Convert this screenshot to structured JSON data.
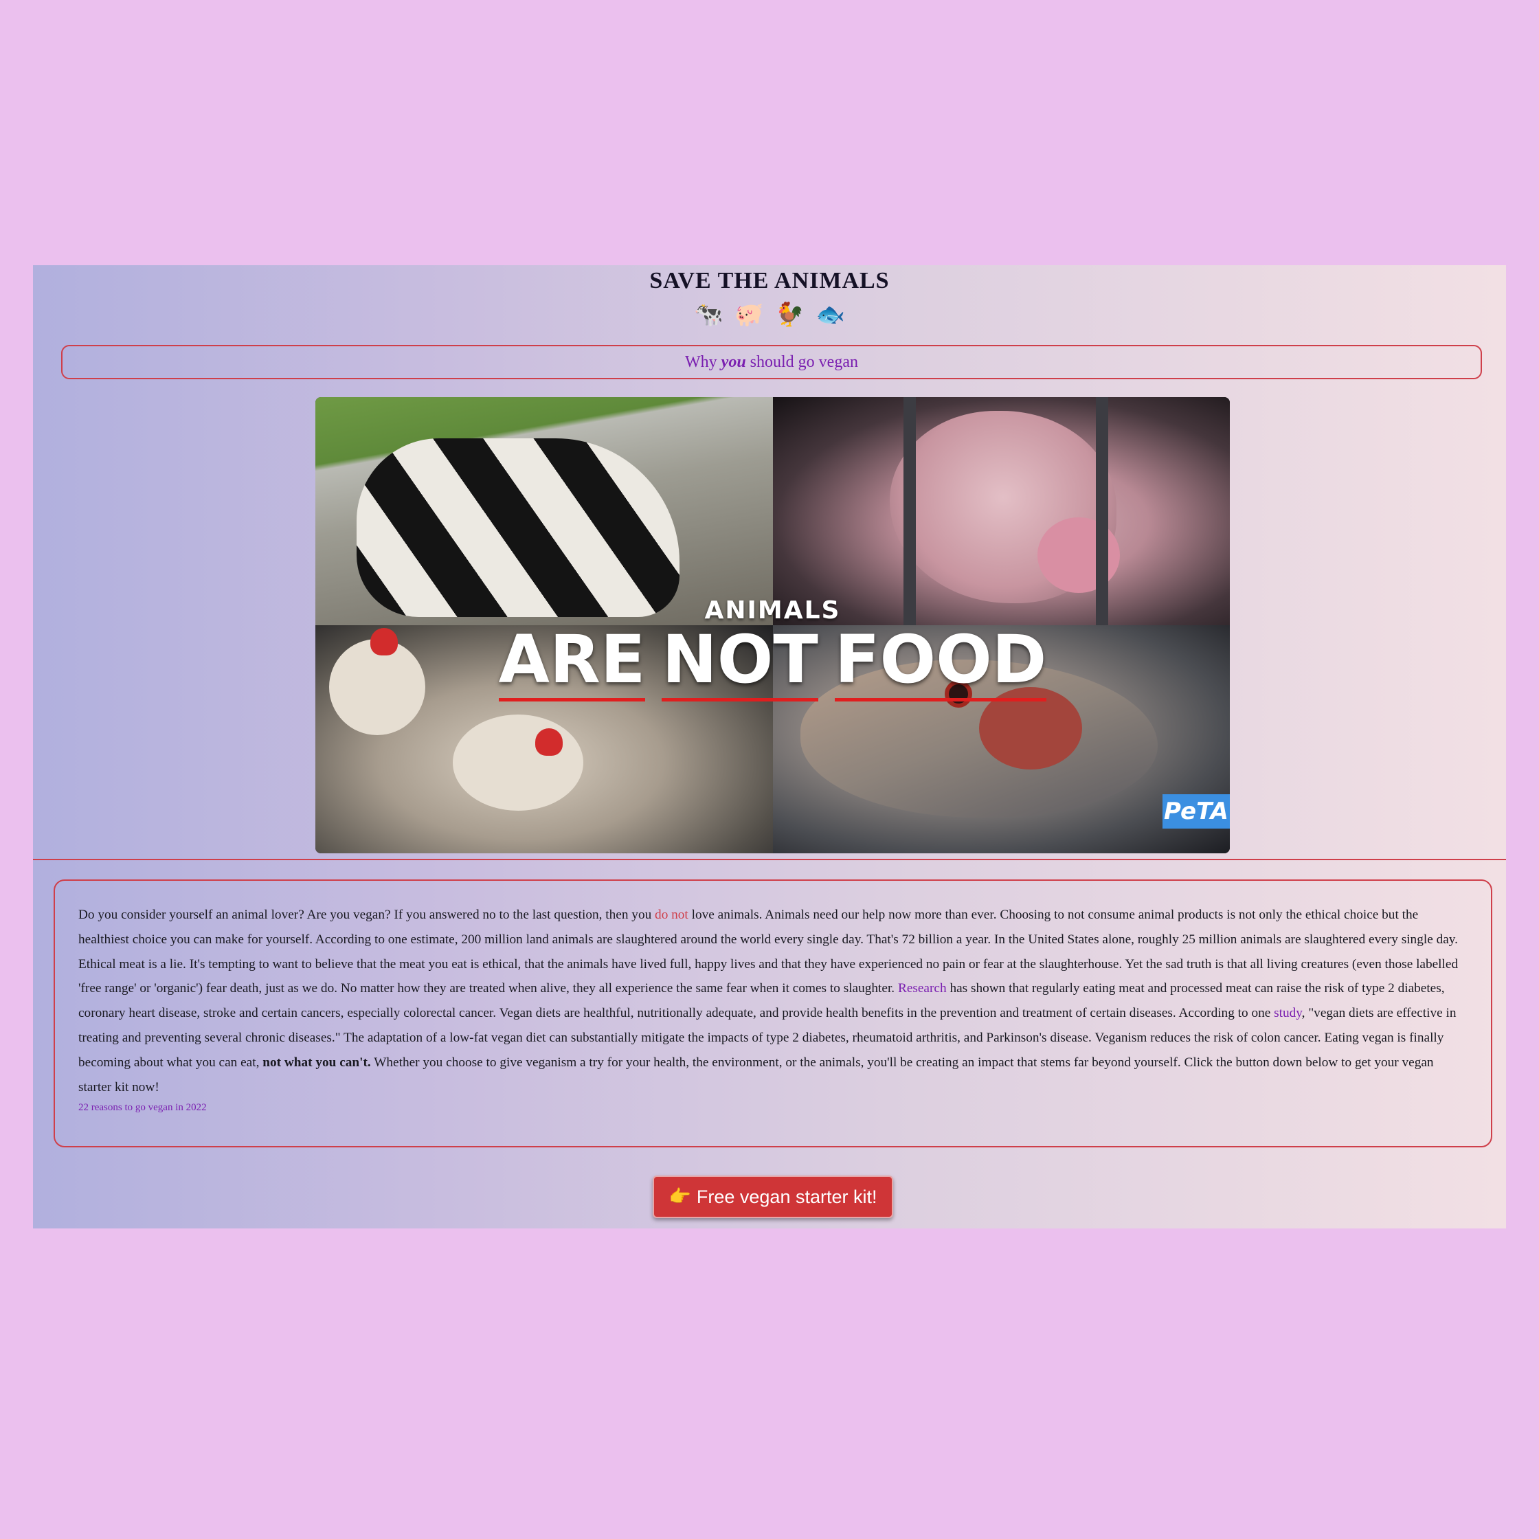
{
  "header": {
    "title": "SAVE THE ANIMALS",
    "animals": [
      "cow-icon",
      "pig-icon",
      "chicken-icon",
      "fish-icon"
    ],
    "animal_glyphs": [
      "🐄",
      "🐖",
      "🐓",
      "🐟"
    ]
  },
  "why": {
    "before": "Why ",
    "emph": "you",
    "after": " should go vegan"
  },
  "hero": {
    "line1": "ANIMALS",
    "word1": "ARE",
    "word2": "NOT",
    "word3": "FOOD",
    "logo": "PeTA"
  },
  "article": {
    "part1": "Do you consider yourself an animal lover? Are you vegan? If you answered no to the last question, then you ",
    "do_not": "do not",
    "part2": " love animals. Animals need our help now more than ever. Choosing to not consume animal products is not only the ethical choice but the healthiest choice you can make for yourself. According to one estimate, 200 million land animals are slaughtered around the world every single day. That's 72 billion a year. In the United States alone, roughly 25 million animals are slaughtered every single day. Ethical meat is a lie. It's tempting to want to believe that the meat you eat is ethical, that the animals have lived full, happy lives and that they have experienced no pain or fear at the slaughterhouse. Yet the sad truth is that all living creatures (even those labelled 'free range' or 'organic') fear death, just as we do. No matter how they are treated when alive, they all experience the same fear when it comes to slaughter. ",
    "research_link": "Research",
    "part3": " has shown that regularly eating meat and processed meat can raise the risk of type 2 diabetes, coronary heart disease, stroke and certain cancers, especially colorectal cancer. Vegan diets are healthful, nutritionally adequate, and provide health benefits in the prevention and treatment of certain diseases. According to one ",
    "study_link": "study",
    "part4": ", \"vegan diets are effective in treating and preventing several chronic diseases.\" The adaptation of a low-fat vegan diet can substantially mitigate the impacts of type 2 diabetes, rheumatoid arthritis, and Parkinson's disease. Veganism reduces the risk of colon cancer. Eating vegan is finally becoming about what you can eat, ",
    "bold": "not what you can't.",
    "part5": " Whether you choose to give veganism a try for your health, the environment, or the animals, you'll be creating an impact that stems far beyond yourself. Click the button down below to get your vegan starter kit now!",
    "reasons_link": "22 reasons to go vegan in 2022"
  },
  "cta": {
    "icon": "pointing-hand-icon",
    "glyph": "👉",
    "label": "Free vegan starter kit!"
  },
  "colors": {
    "page_bg": "#ebc0ee",
    "accent_red": "#cf3f4a",
    "link_purple": "#7a1fb0",
    "button_red": "#cf3537"
  }
}
